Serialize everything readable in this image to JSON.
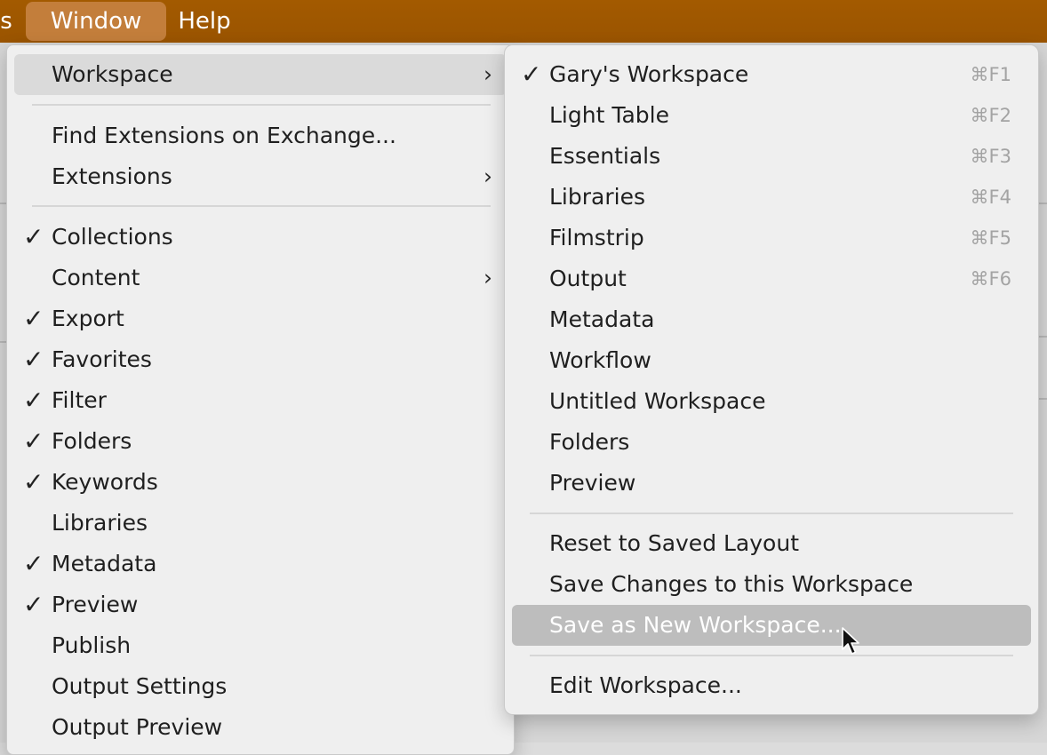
{
  "menubar": {
    "items": [
      {
        "label": "s",
        "active": false
      },
      {
        "label": "Window",
        "active": true
      },
      {
        "label": "Help",
        "active": false
      }
    ]
  },
  "window_menu": {
    "items": [
      {
        "label": "Workspace",
        "checked": false,
        "submenu": true,
        "highlighted": true
      },
      {
        "separator": true
      },
      {
        "label": "Find Extensions on Exchange...",
        "checked": false,
        "submenu": false
      },
      {
        "label": "Extensions",
        "checked": false,
        "submenu": true
      },
      {
        "separator": true
      },
      {
        "label": "Collections",
        "checked": true,
        "submenu": false
      },
      {
        "label": "Content",
        "checked": false,
        "submenu": true
      },
      {
        "label": "Export",
        "checked": true,
        "submenu": false
      },
      {
        "label": "Favorites",
        "checked": true,
        "submenu": false
      },
      {
        "label": "Filter",
        "checked": true,
        "submenu": false
      },
      {
        "label": "Folders",
        "checked": true,
        "submenu": false
      },
      {
        "label": "Keywords",
        "checked": true,
        "submenu": false
      },
      {
        "label": "Libraries",
        "checked": false,
        "submenu": false
      },
      {
        "label": "Metadata",
        "checked": true,
        "submenu": false
      },
      {
        "label": "Preview",
        "checked": true,
        "submenu": false
      },
      {
        "label": "Publish",
        "checked": false,
        "submenu": false
      },
      {
        "label": "Output Settings",
        "checked": false,
        "submenu": false
      },
      {
        "label": "Output Preview",
        "checked": false,
        "submenu": false
      }
    ]
  },
  "workspace_submenu": {
    "items": [
      {
        "label": "Gary's Workspace",
        "checked": true,
        "shortcut": "⌘F1"
      },
      {
        "label": "Light Table",
        "checked": false,
        "shortcut": "⌘F2"
      },
      {
        "label": "Essentials",
        "checked": false,
        "shortcut": "⌘F3"
      },
      {
        "label": "Libraries",
        "checked": false,
        "shortcut": "⌘F4"
      },
      {
        "label": "Filmstrip",
        "checked": false,
        "shortcut": "⌘F5"
      },
      {
        "label": "Output",
        "checked": false,
        "shortcut": "⌘F6"
      },
      {
        "label": "Metadata",
        "checked": false,
        "shortcut": ""
      },
      {
        "label": "Workflow",
        "checked": false,
        "shortcut": ""
      },
      {
        "label": "Untitled Workspace",
        "checked": false,
        "shortcut": ""
      },
      {
        "label": "Folders",
        "checked": false,
        "shortcut": ""
      },
      {
        "label": "Preview",
        "checked": false,
        "shortcut": ""
      },
      {
        "separator": true
      },
      {
        "label": "Reset to Saved Layout",
        "checked": false,
        "shortcut": ""
      },
      {
        "label": "Save Changes to this Workspace",
        "checked": false,
        "shortcut": ""
      },
      {
        "label": "Save as New Workspace...",
        "checked": false,
        "shortcut": "",
        "selected": true
      },
      {
        "separator": true
      },
      {
        "label": "Edit Workspace...",
        "checked": false,
        "shortcut": ""
      }
    ]
  },
  "icons": {
    "check": "checkmark-icon",
    "arrow": "chevron-right-icon",
    "cursor": "mouse-pointer-icon"
  },
  "colors": {
    "menubar": "#9d5600",
    "menubar_active": "#c37e3b",
    "menu_bg": "#efefef",
    "highlight": "#dadada",
    "selected": "#bdbdbd",
    "shortcut_text": "#a3a3a3"
  }
}
